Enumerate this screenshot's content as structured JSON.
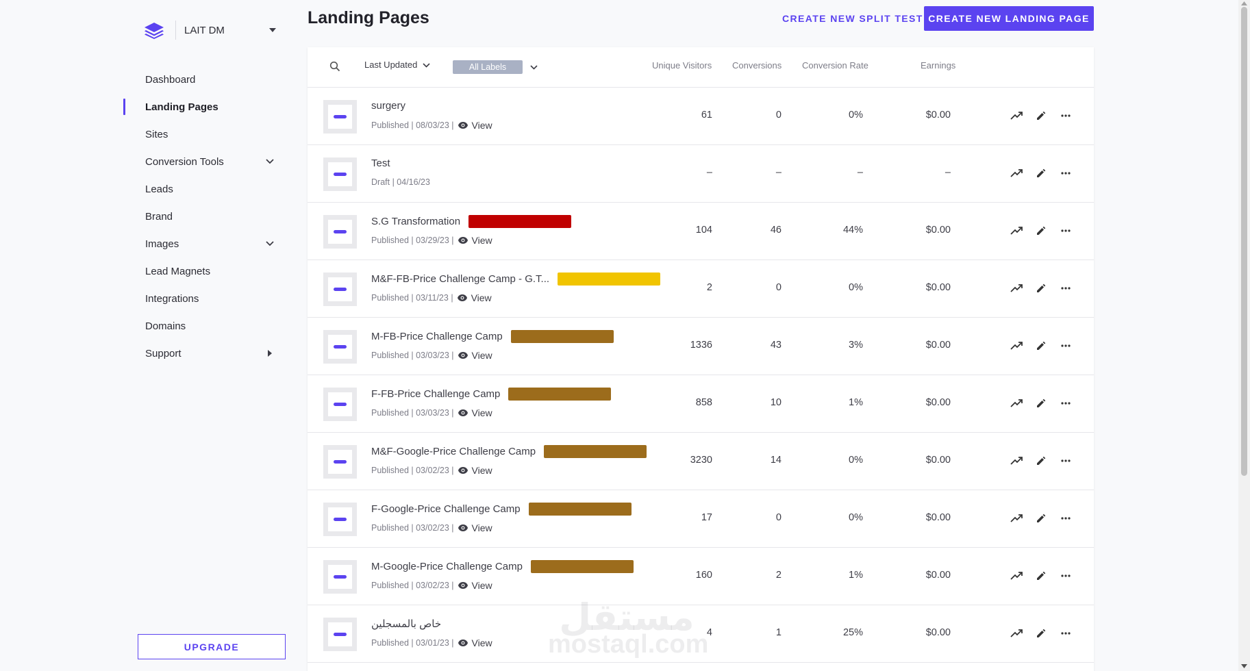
{
  "workspace": {
    "name": "LAIT DM"
  },
  "sidebar": {
    "items": [
      {
        "label": "Dashboard"
      },
      {
        "label": "Landing Pages"
      },
      {
        "label": "Sites"
      },
      {
        "label": "Conversion Tools"
      },
      {
        "label": "Leads"
      },
      {
        "label": "Brand"
      },
      {
        "label": "Images"
      },
      {
        "label": "Lead Magnets"
      },
      {
        "label": "Integrations"
      },
      {
        "label": "Domains"
      },
      {
        "label": "Support"
      }
    ],
    "upgrade_label": "UPGRADE"
  },
  "header": {
    "title": "Landing Pages",
    "split_test_label": "CREATE NEW SPLIT TEST",
    "create_label": "CREATE NEW LANDING PAGE"
  },
  "table": {
    "sort_label": "Last Updated",
    "labels_filter": "All Labels",
    "columns": {
      "unique_visitors": "Unique Visitors",
      "conversions": "Conversions",
      "conversion_rate": "Conversion Rate",
      "earnings": "Earnings"
    },
    "view_label": "View",
    "rows": [
      {
        "name": "surgery",
        "status": "Published",
        "date": "08/03/23",
        "uv": "61",
        "conv": "0",
        "rate": "0%",
        "earn": "$0.00",
        "label_color": ""
      },
      {
        "name": "Test",
        "status": "Draft",
        "date": "04/16/23",
        "uv": "–",
        "conv": "–",
        "rate": "–",
        "earn": "–",
        "label_color": ""
      },
      {
        "name": "S.G Transformation",
        "status": "Published",
        "date": "03/29/23",
        "uv": "104",
        "conv": "46",
        "rate": "44%",
        "earn": "$0.00",
        "label_color": "#c00000"
      },
      {
        "name": "M&F-FB-Price Challenge Camp - G.T...",
        "status": "Published",
        "date": "03/11/23",
        "uv": "2",
        "conv": "0",
        "rate": "0%",
        "earn": "$0.00",
        "label_color": "#f1c400"
      },
      {
        "name": "M-FB-Price Challenge Camp",
        "status": "Published",
        "date": "03/03/23",
        "uv": "1336",
        "conv": "43",
        "rate": "3%",
        "earn": "$0.00",
        "label_color": "#9c6c1c"
      },
      {
        "name": "F-FB-Price Challenge Camp",
        "status": "Published",
        "date": "03/03/23",
        "uv": "858",
        "conv": "10",
        "rate": "1%",
        "earn": "$0.00",
        "label_color": "#9c6c1c"
      },
      {
        "name": "M&F-Google-Price Challenge Camp",
        "status": "Published",
        "date": "03/02/23",
        "uv": "3230",
        "conv": "14",
        "rate": "0%",
        "earn": "$0.00",
        "label_color": "#9c6c1c"
      },
      {
        "name": "F-Google-Price Challenge Camp",
        "status": "Published",
        "date": "03/02/23",
        "uv": "17",
        "conv": "0",
        "rate": "0%",
        "earn": "$0.00",
        "label_color": "#9c6c1c"
      },
      {
        "name": "M-Google-Price Challenge Camp",
        "status": "Published",
        "date": "03/02/23",
        "uv": "160",
        "conv": "2",
        "rate": "1%",
        "earn": "$0.00",
        "label_color": "#9c6c1c"
      },
      {
        "name": "خاص بالمسجلين",
        "status": "Published",
        "date": "03/01/23",
        "uv": "4",
        "conv": "1",
        "rate": "25%",
        "earn": "$0.00",
        "label_color": ""
      }
    ]
  },
  "watermark": {
    "arabic": "مستقل",
    "latin": "mostaql.com"
  },
  "colors": {
    "accent": "#5b43f0",
    "label_red": "#c00000",
    "label_yellow": "#f1c400",
    "label_brown": "#9c6c1c"
  }
}
